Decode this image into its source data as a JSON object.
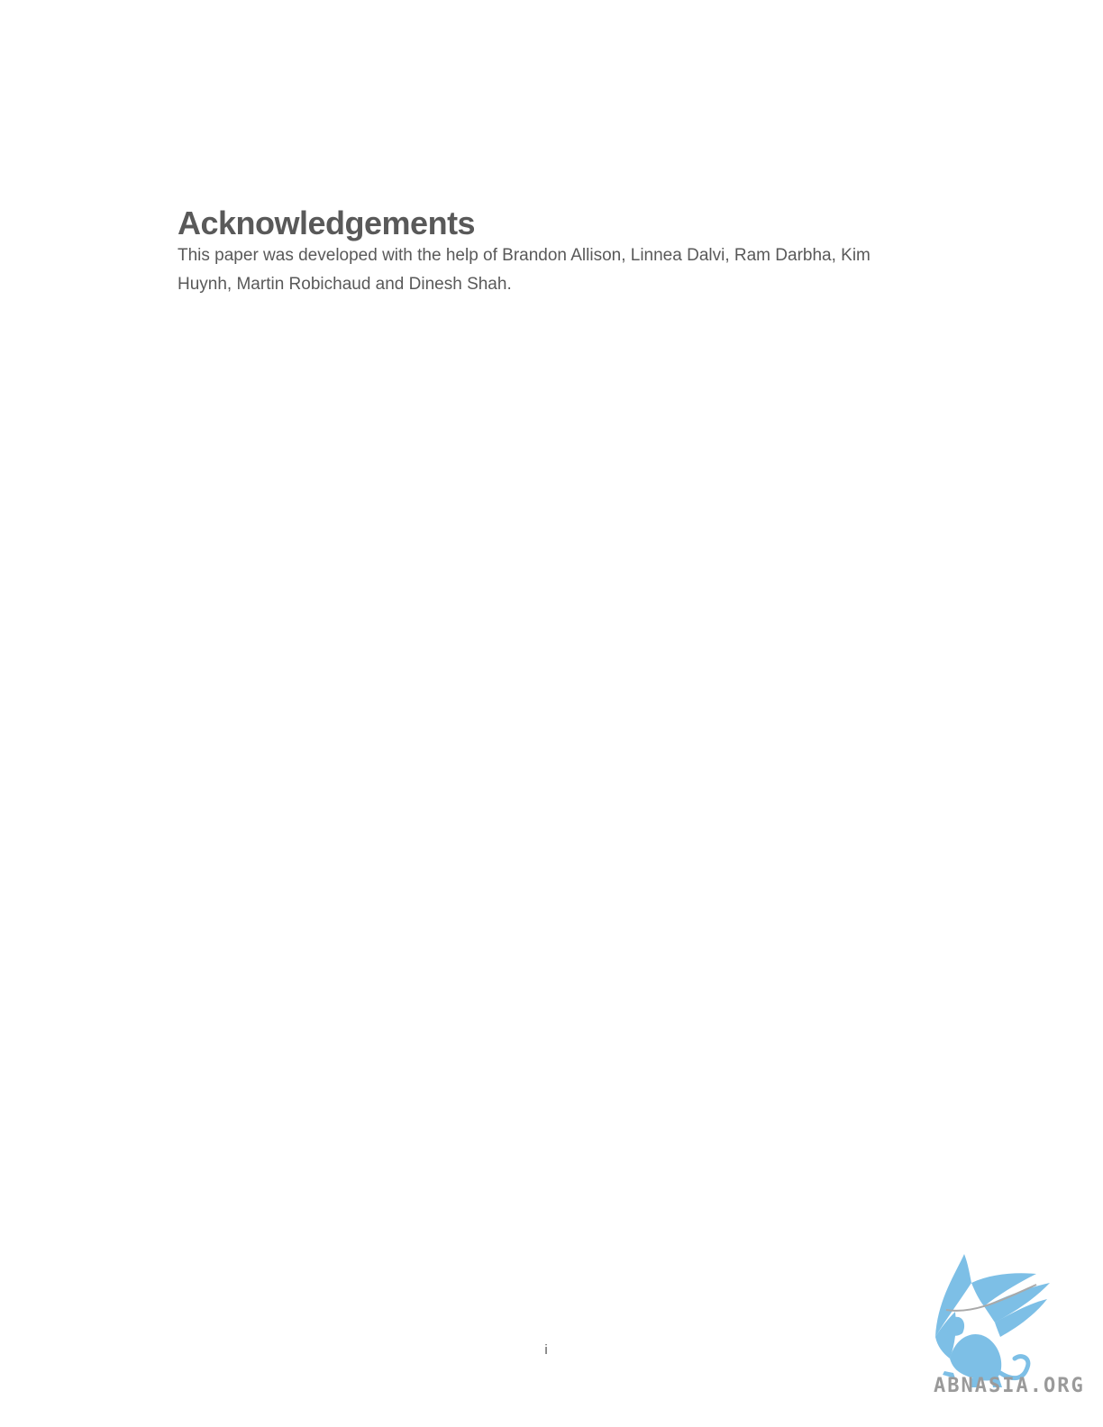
{
  "document": {
    "heading": "Acknowledgements",
    "paragraph": "This paper was developed with the help of Brandon Allison, Linnea Dalvi, Ram Darbha, Kim Huynh, Martin Robichaud and Dinesh Shah.",
    "page_number": "i"
  },
  "watermark": {
    "text": "ABNASIA.ORG",
    "icon": "griffin-logo-icon",
    "color": "#7dbfe6"
  }
}
